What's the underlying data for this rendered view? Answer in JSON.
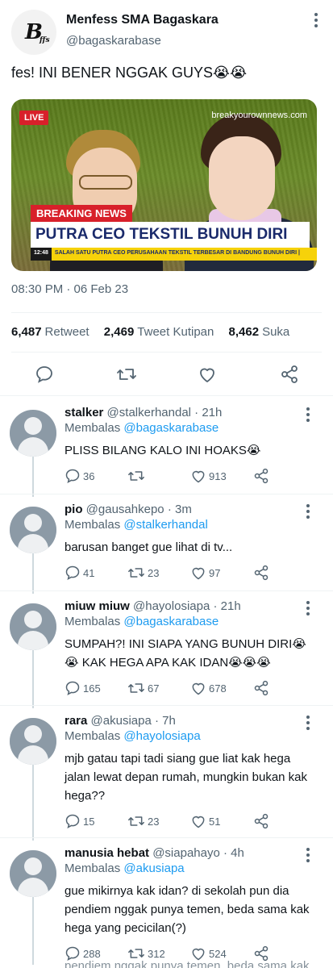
{
  "tweet": {
    "author_name": "Menfess SMA Bagaskara",
    "author_handle": "@bagaskarabase",
    "avatar_logo": "B",
    "avatar_logo_small": "ffs",
    "text": "fes! INI BENER NGGAK GUYS😭😭",
    "media": {
      "live_label": "LIVE",
      "watermark": "breakyourownnews.com",
      "breaking_label": "BREAKING NEWS",
      "headline": "PUTRA CEO TEKSTIL BUNUH DIRI",
      "ticker_time": "12:48",
      "ticker_text": "SALAH SATU PUTRA CEO PERUSAHAAN TEKSTIL TERBESAR DI BANDUNG BUNUH DIRI |"
    },
    "timestamp": "08:30 PM · 06 Feb 23",
    "stats": {
      "retweets": "6,487",
      "retweets_label": "Retweet",
      "quotes": "2,469",
      "quotes_label": "Tweet Kutipan",
      "likes": "8,462",
      "likes_label": "Suka"
    }
  },
  "replies": [
    {
      "name": "stalker",
      "handle": "@stalkerhandal",
      "time": "21h",
      "replying_prefix": "Membalas",
      "replying_to": "@bagaskarabase",
      "text": "PLISS BILANG KALO INI HOAKS😭",
      "replies": "36",
      "retweets": "",
      "likes": "913"
    },
    {
      "name": "pio",
      "handle": "@gausahkepo",
      "time": "3m",
      "replying_prefix": "Membalas",
      "replying_to": "@stalkerhandal",
      "text": "barusan banget gue lihat di tv...",
      "replies": "41",
      "retweets": "23",
      "likes": "97"
    },
    {
      "name": "miuw miuw",
      "handle": "@hayolosiapa",
      "time": "21h",
      "replying_prefix": "Membalas",
      "replying_to": "@bagaskarabase",
      "text": "SUMPAH?! INI SIAPA YANG BUNUH DIRI😭😭 KAK HEGA APA KAK IDAN😭😭😭",
      "replies": "165",
      "retweets": "67",
      "likes": "678"
    },
    {
      "name": "rara",
      "handle": "@akusiapa",
      "time": "7h",
      "replying_prefix": "Membalas",
      "replying_to": "@hayolosiapa",
      "text": "mjb gatau tapi tadi siang gue liat kak hega jalan lewat depan rumah, mungkin bukan kak hega??",
      "replies": "15",
      "retweets": "23",
      "likes": "51"
    },
    {
      "name": "manusia hebat",
      "handle": "@siapahayo",
      "time": "4h",
      "replying_prefix": "Membalas",
      "replying_to": "@akusiapa",
      "text": "gue mikirnya kak idan? di sekolah pun dia pendiem nggak punya temen, beda sama kak hega yang pecicilan(?)",
      "replies": "288",
      "retweets": "312",
      "likes": "524"
    }
  ],
  "overflow_text": "pendiem nggak punya temen, beda sama kak"
}
